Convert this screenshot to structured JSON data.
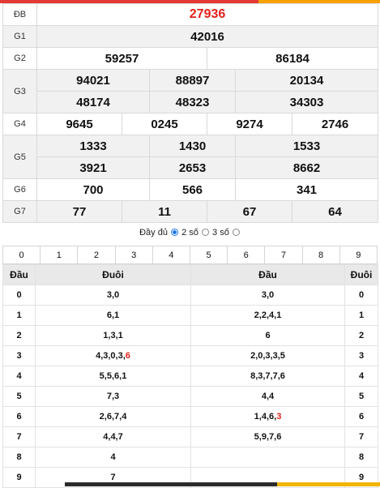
{
  "colors": {
    "accent_red": "#e3211c",
    "top_bar_red": "#e53935",
    "top_bar_orange": "#f6a100"
  },
  "results": {
    "db": {
      "label": "ĐB",
      "value": "27936"
    },
    "g1": {
      "label": "G1",
      "values": [
        "42016"
      ]
    },
    "g2": {
      "label": "G2",
      "values": [
        "59257",
        "86184"
      ]
    },
    "g3": {
      "label": "G3",
      "values": [
        "94021",
        "88897",
        "20134",
        "48174",
        "48323",
        "34303"
      ]
    },
    "g4": {
      "label": "G4",
      "values": [
        "9645",
        "0245",
        "9274",
        "2746"
      ]
    },
    "g5": {
      "label": "G5",
      "values": [
        "1333",
        "1430",
        "1533",
        "3921",
        "2653",
        "8662"
      ]
    },
    "g6": {
      "label": "G6",
      "values": [
        "700",
        "566",
        "341"
      ]
    },
    "g7": {
      "label": "G7",
      "values": [
        "77",
        "11",
        "67",
        "64"
      ]
    }
  },
  "options": {
    "full": "Đầy đủ",
    "two": "2 số",
    "three": "3 số"
  },
  "digits": [
    "0",
    "1",
    "2",
    "3",
    "4",
    "5",
    "6",
    "7",
    "8",
    "9"
  ],
  "loto": {
    "headers": {
      "dau": "Đầu",
      "duoi": "Đuôi",
      "dau2": "Đầu",
      "duoi2": "Đuôi"
    },
    "rows": [
      {
        "d": "0",
        "left": "3,0",
        "right": "3,0",
        "e": "0"
      },
      {
        "d": "1",
        "left": "6,1",
        "right": "2,2,4,1",
        "e": "1"
      },
      {
        "d": "2",
        "left": "1,3,1",
        "right": "6",
        "e": "2"
      },
      {
        "d": "3",
        "left": "4,3,0,3,",
        "left_red": "6",
        "right": "2,0,3,3,5",
        "e": "3"
      },
      {
        "d": "4",
        "left": "5,5,6,1",
        "right": "8,3,7,7,6",
        "e": "4"
      },
      {
        "d": "5",
        "left": "7,3",
        "right": "4,4",
        "e": "5"
      },
      {
        "d": "6",
        "left": "2,6,7,4",
        "right": "1,4,6,",
        "right_red": "3",
        "e": "6"
      },
      {
        "d": "7",
        "left": "4,4,7",
        "right": "5,9,7,6",
        "e": "7"
      },
      {
        "d": "8",
        "left": "4",
        "right": "",
        "e": "8"
      },
      {
        "d": "9",
        "left": "7",
        "right": "",
        "e": "9"
      }
    ]
  }
}
